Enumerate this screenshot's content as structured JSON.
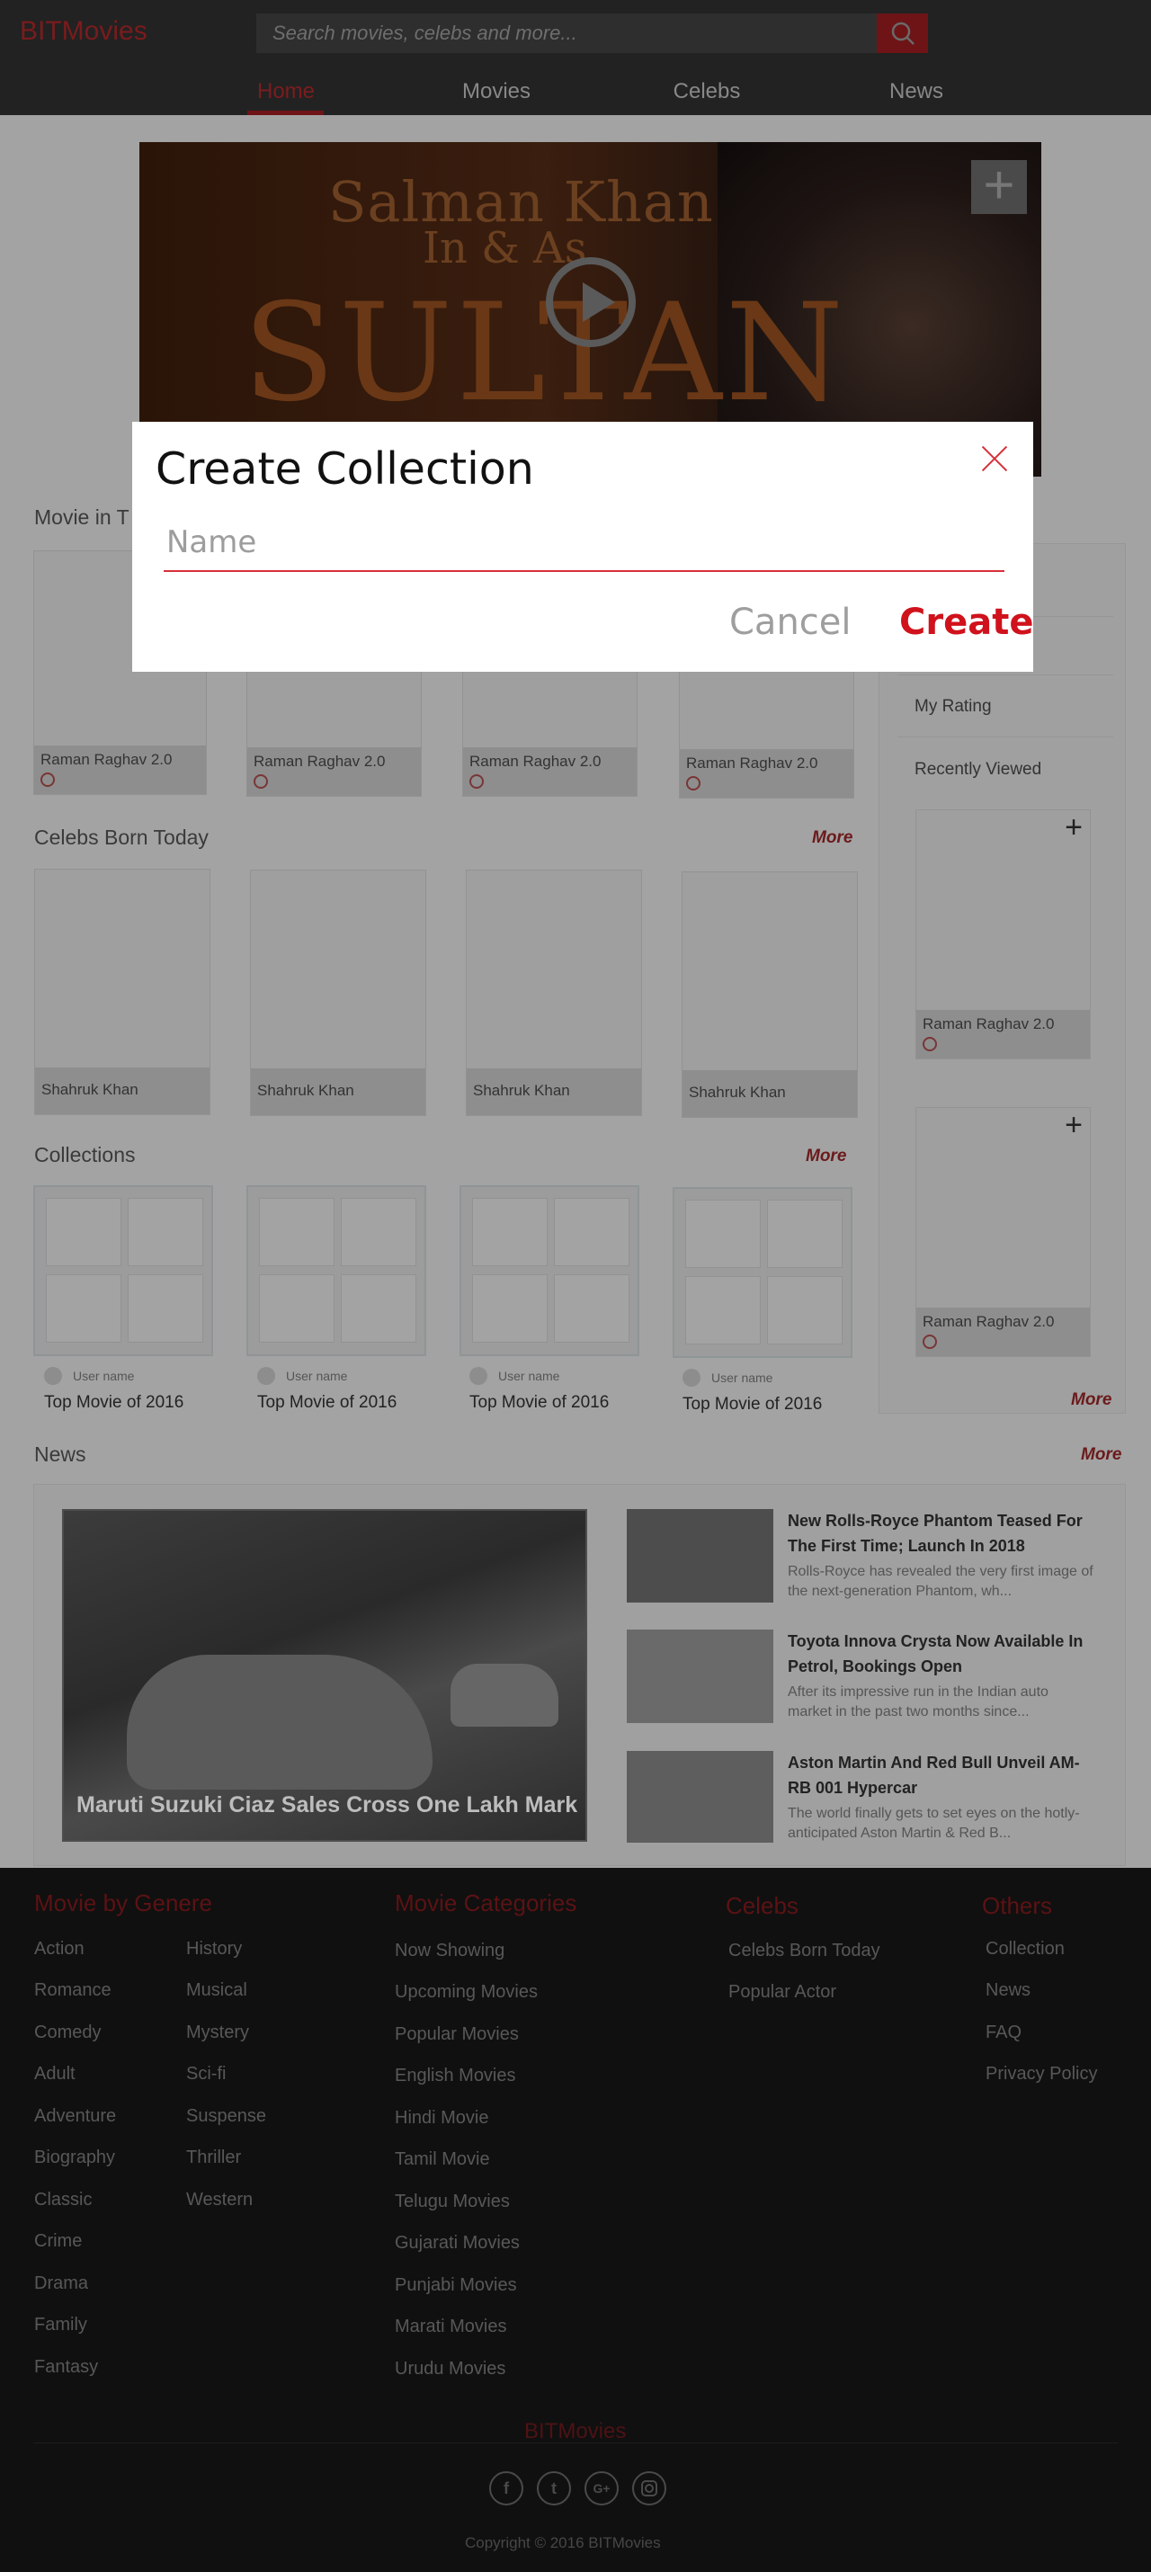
{
  "header": {
    "logo": "BITMovies",
    "search_placeholder": "Search movies, celebs and more...",
    "nav": [
      "Home",
      "Movies",
      "Celebs",
      "News"
    ],
    "active_nav": "Home"
  },
  "hero": {
    "line1": "Salman Khan",
    "line2": "In & As",
    "line3": "SULTAN"
  },
  "movie_section": {
    "title": "Movie in T",
    "cards": [
      "Raman Raghav 2.0",
      "Raman Raghav 2.0",
      "Raman Raghav 2.0",
      "Raman Raghav 2.0"
    ]
  },
  "sidebar": {
    "items": [
      "My Rating",
      "Recently Viewed"
    ],
    "cards": [
      "Raman Raghav 2.0",
      "Raman Raghav 2.0"
    ],
    "more": "More"
  },
  "celebs_section": {
    "title": "Celebs Born Today",
    "more": "More",
    "cards": [
      "Shahruk Khan",
      "Shahruk Khan",
      "Shahruk Khan",
      "Shahruk Khan"
    ]
  },
  "collections_section": {
    "title": "Collections",
    "more": "More",
    "items": [
      {
        "user": "User name",
        "title": "Top Movie of 2016"
      },
      {
        "user": "User name",
        "title": "Top Movie of 2016"
      },
      {
        "user": "User name",
        "title": "Top Movie of 2016"
      },
      {
        "user": "User name",
        "title": "Top Movie of 2016"
      }
    ]
  },
  "news_section": {
    "title": "News",
    "more": "More",
    "main_caption": "Maruti Suzuki Ciaz Sales Cross One Lakh Mark",
    "items": [
      {
        "headline": "New Rolls-Royce Phantom Teased For The First Time; Launch In 2018",
        "summary": "Rolls-Royce has revealed the very first image of the next-generation Phantom, wh..."
      },
      {
        "headline": "Toyota Innova Crysta Now Available In Petrol, Bookings Open",
        "summary": "After its impressive run in the Indian auto market in the past two months since..."
      },
      {
        "headline": "Aston Martin And Red Bull Unveil AM-RB 001 Hypercar",
        "summary": "The world finally gets to set eyes on the hotly-anticipated Aston Martin & Red B..."
      }
    ]
  },
  "footer": {
    "genre_title": "Movie by Genere",
    "genres_col1": [
      "Action",
      "Romance",
      "Comedy",
      "Adult",
      "Adventure",
      "Biography",
      "Classic",
      "Crime",
      "Drama",
      "Family",
      "Fantasy"
    ],
    "genres_col2": [
      "History",
      "Musical",
      "Mystery",
      "Sci-fi",
      "Suspense",
      "Thriller",
      "Western"
    ],
    "categories_title": "Movie Categories",
    "categories": [
      "Now Showing",
      "Upcoming Movies",
      "Popular Movies",
      "English Movies",
      "Hindi Movie",
      "Tamil Movie",
      "Telugu Movies",
      "Gujarati Movies",
      "Punjabi Movies",
      "Marati Movies",
      "Urudu Movies"
    ],
    "celebs_title": "Celebs",
    "celebs": [
      "Celebs Born Today",
      "Popular Actor"
    ],
    "others_title": "Others",
    "others": [
      "Collection",
      "News",
      "FAQ",
      "Privacy Policy"
    ],
    "logo": "BITMovies",
    "social": [
      "f",
      "t",
      "G+",
      "ig"
    ],
    "copyright": "Copyright © 2016 BITMovies"
  },
  "modal": {
    "title": "Create Collection",
    "name_placeholder": "Name",
    "cancel": "Cancel",
    "create": "Create"
  }
}
